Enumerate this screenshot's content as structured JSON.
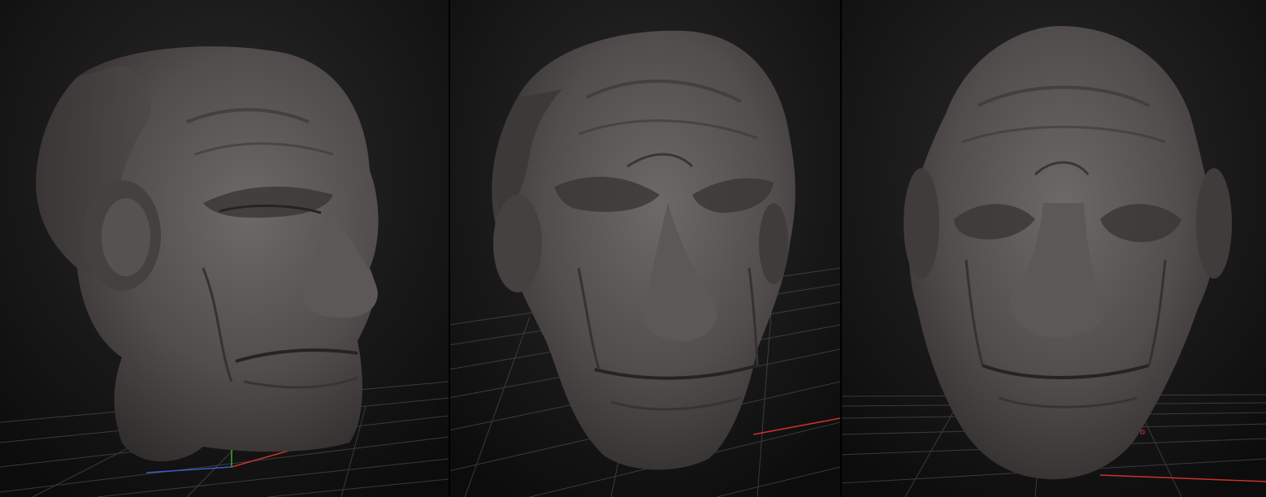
{
  "app": {
    "background_color": "#141414",
    "grid_color": "#6a6a6a",
    "axis_x_color": "#c8332e",
    "axis_y_color": "#2fb33a",
    "axis_z_color": "#3a5cc8",
    "sculpt_base_color": "#4e4a4a",
    "sculpt_highlight_color": "#6c6767",
    "sculpt_shadow_color": "#2a2727"
  },
  "viewports": [
    {
      "view": "three-quarter-left",
      "show_axes": true
    },
    {
      "view": "three-quarter-front",
      "show_axes": true
    },
    {
      "view": "front",
      "show_axes": true
    }
  ]
}
